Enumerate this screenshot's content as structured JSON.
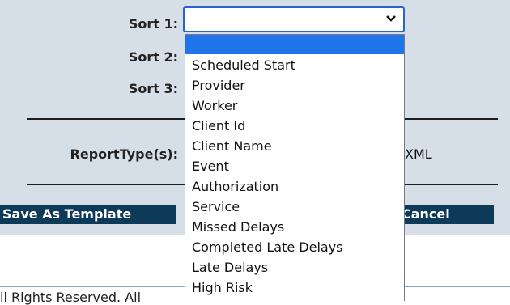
{
  "form": {
    "sort1_label": "Sort 1:",
    "sort2_label": "Sort 2:",
    "sort3_label": "Sort 3:",
    "report_type_label": "ReportType(s):",
    "report_type_option": "XML",
    "sort1_value": ""
  },
  "actions": {
    "save_template_label": "Save As Template",
    "cancel_label": "Cancel"
  },
  "footer": {
    "text": "ll Rights Reserved. All"
  },
  "dropdown": {
    "options": [
      "",
      "Scheduled Start",
      "Provider",
      "Worker",
      "Client Id",
      "Client Name",
      "Event",
      "Authorization",
      "Service",
      "Missed Delays",
      "Completed Late Delays",
      "Late Delays",
      "High Risk"
    ]
  },
  "colors": {
    "panel_bg": "#d6dfe7",
    "bar_bg": "#0e3a59",
    "select_border": "#2a63c9",
    "highlight": "#1e74e8"
  }
}
